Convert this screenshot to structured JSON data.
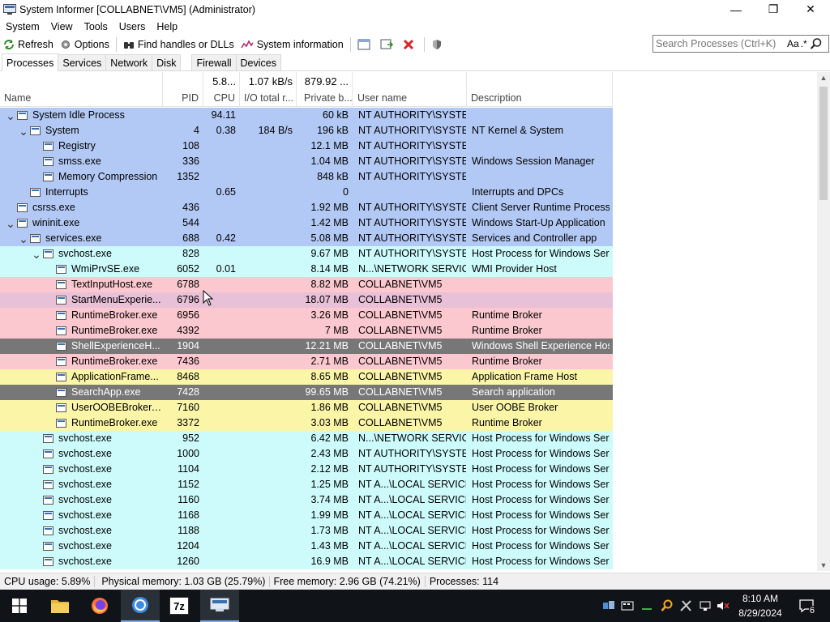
{
  "window": {
    "title": "System Informer [COLLABNET\\VM5] (Administrator)",
    "minimize": "—",
    "maximize": "❐",
    "close": "✕"
  },
  "menu": [
    "System",
    "View",
    "Tools",
    "Users",
    "Help"
  ],
  "toolbar": {
    "refresh": "Refresh",
    "options": "Options",
    "find_handles": "Find handles or DLLs",
    "system_information": "System information"
  },
  "search": {
    "placeholder": "Search Processes (Ctrl+K)",
    "case_label": "Aa",
    "regex_label": ".*"
  },
  "tabs": [
    "Processes",
    "Services",
    "Network",
    "Disk",
    "Firewall",
    "Devices"
  ],
  "columns": {
    "name": "Name",
    "pid": "PID",
    "cpu": "CPU",
    "io": "I/O total r...",
    "private": "Private b...",
    "user": "User name",
    "description": "Description"
  },
  "totals": {
    "cpu": "5.8...",
    "io": "1.07 kB/s",
    "private": "879.92 ..."
  },
  "colors": {
    "system": "#b3c9f5",
    "service": "#cdfbfb",
    "own": "#fbc8cf",
    "suspended_dark": "#777777",
    "immersive": "#fbf5a8",
    "selected_hover": "#e8c0d8"
  },
  "processes": [
    {
      "level": 0,
      "exp": "open",
      "name": "System Idle Process",
      "pid": "",
      "cpu": "94.11",
      "io": "",
      "priv": "60 kB",
      "user": "NT AUTHORITY\\SYSTEM",
      "desc": "",
      "color": "system"
    },
    {
      "level": 1,
      "exp": "open",
      "name": "System",
      "pid": "4",
      "cpu": "0.38",
      "io": "184 B/s",
      "priv": "196 kB",
      "user": "NT AUTHORITY\\SYSTEM",
      "desc": "NT Kernel & System",
      "color": "system"
    },
    {
      "level": 2,
      "exp": "",
      "name": "Registry",
      "pid": "108",
      "cpu": "",
      "io": "",
      "priv": "12.1 MB",
      "user": "NT AUTHORITY\\SYSTEM",
      "desc": "",
      "color": "system"
    },
    {
      "level": 2,
      "exp": "",
      "name": "smss.exe",
      "pid": "336",
      "cpu": "",
      "io": "",
      "priv": "1.04 MB",
      "user": "NT AUTHORITY\\SYSTEM",
      "desc": "Windows Session Manager",
      "color": "system"
    },
    {
      "level": 2,
      "exp": "",
      "name": "Memory Compression",
      "pid": "1352",
      "cpu": "",
      "io": "",
      "priv": "848 kB",
      "user": "NT AUTHORITY\\SYSTEM",
      "desc": "",
      "color": "system"
    },
    {
      "level": 1,
      "exp": "",
      "name": "Interrupts",
      "pid": "",
      "cpu": "0.65",
      "io": "",
      "priv": "0",
      "user": "",
      "desc": "Interrupts and DPCs",
      "color": "system"
    },
    {
      "level": 0,
      "exp": "",
      "name": "csrss.exe",
      "pid": "436",
      "cpu": "",
      "io": "",
      "priv": "1.92 MB",
      "user": "NT AUTHORITY\\SYSTEM",
      "desc": "Client Server Runtime Process",
      "color": "system"
    },
    {
      "level": 0,
      "exp": "open",
      "name": "wininit.exe",
      "pid": "544",
      "cpu": "",
      "io": "",
      "priv": "1.42 MB",
      "user": "NT AUTHORITY\\SYSTEM",
      "desc": "Windows Start-Up Application",
      "color": "system"
    },
    {
      "level": 1,
      "exp": "open",
      "name": "services.exe",
      "pid": "688",
      "cpu": "0.42",
      "io": "",
      "priv": "5.08 MB",
      "user": "NT AUTHORITY\\SYSTEM",
      "desc": "Services and Controller app",
      "color": "system"
    },
    {
      "level": 2,
      "exp": "open",
      "name": "svchost.exe",
      "pid": "828",
      "cpu": "",
      "io": "",
      "priv": "9.67 MB",
      "user": "NT AUTHORITY\\SYSTEM",
      "desc": "Host Process for Windows Ser...",
      "color": "service"
    },
    {
      "level": 3,
      "exp": "",
      "name": "WmiPrvSE.exe",
      "pid": "6052",
      "cpu": "0.01",
      "io": "",
      "priv": "8.14 MB",
      "user": "N...\\NETWORK SERVICE",
      "desc": "WMI Provider Host",
      "color": "service"
    },
    {
      "level": 3,
      "exp": "",
      "name": "TextInputHost.exe",
      "pid": "6788",
      "cpu": "",
      "io": "",
      "priv": "8.82 MB",
      "user": "COLLABNET\\VM5",
      "desc": "",
      "color": "own"
    },
    {
      "level": 3,
      "exp": "",
      "name": "StartMenuExperie...",
      "pid": "6796",
      "cpu": "",
      "io": "",
      "priv": "18.07 MB",
      "user": "COLLABNET\\VM5",
      "desc": "",
      "color": "selected_hover"
    },
    {
      "level": 3,
      "exp": "",
      "name": "RuntimeBroker.exe",
      "pid": "6956",
      "cpu": "",
      "io": "",
      "priv": "3.26 MB",
      "user": "COLLABNET\\VM5",
      "desc": "Runtime Broker",
      "color": "own"
    },
    {
      "level": 3,
      "exp": "",
      "name": "RuntimeBroker.exe",
      "pid": "4392",
      "cpu": "",
      "io": "",
      "priv": "7 MB",
      "user": "COLLABNET\\VM5",
      "desc": "Runtime Broker",
      "color": "own"
    },
    {
      "level": 3,
      "exp": "",
      "name": "ShellExperienceH...",
      "pid": "1904",
      "cpu": "",
      "io": "",
      "priv": "12.21 MB",
      "user": "COLLABNET\\VM5",
      "desc": "Windows Shell Experience Host",
      "color": "suspended_dark"
    },
    {
      "level": 3,
      "exp": "",
      "name": "RuntimeBroker.exe",
      "pid": "7436",
      "cpu": "",
      "io": "",
      "priv": "2.71 MB",
      "user": "COLLABNET\\VM5",
      "desc": "Runtime Broker",
      "color": "own"
    },
    {
      "level": 3,
      "exp": "",
      "name": "ApplicationFrame...",
      "pid": "8468",
      "cpu": "",
      "io": "",
      "priv": "8.65 MB",
      "user": "COLLABNET\\VM5",
      "desc": "Application Frame Host",
      "color": "immersive"
    },
    {
      "level": 3,
      "exp": "",
      "name": "SearchApp.exe",
      "pid": "7428",
      "cpu": "",
      "io": "",
      "priv": "99.65 MB",
      "user": "COLLABNET\\VM5",
      "desc": "Search application",
      "color": "suspended_dark"
    },
    {
      "level": 3,
      "exp": "",
      "name": "UserOOBEBroker....",
      "pid": "7160",
      "cpu": "",
      "io": "",
      "priv": "1.86 MB",
      "user": "COLLABNET\\VM5",
      "desc": "User OOBE Broker",
      "color": "immersive"
    },
    {
      "level": 3,
      "exp": "",
      "name": "RuntimeBroker.exe",
      "pid": "3372",
      "cpu": "",
      "io": "",
      "priv": "3.03 MB",
      "user": "COLLABNET\\VM5",
      "desc": "Runtime Broker",
      "color": "immersive"
    },
    {
      "level": 2,
      "exp": "",
      "name": "svchost.exe",
      "pid": "952",
      "cpu": "",
      "io": "",
      "priv": "6.42 MB",
      "user": "N...\\NETWORK SERVICE",
      "desc": "Host Process for Windows Ser...",
      "color": "service"
    },
    {
      "level": 2,
      "exp": "",
      "name": "svchost.exe",
      "pid": "1000",
      "cpu": "",
      "io": "",
      "priv": "2.43 MB",
      "user": "NT AUTHORITY\\SYSTEM",
      "desc": "Host Process for Windows Ser...",
      "color": "service"
    },
    {
      "level": 2,
      "exp": "",
      "name": "svchost.exe",
      "pid": "1104",
      "cpu": "",
      "io": "",
      "priv": "2.12 MB",
      "user": "NT AUTHORITY\\SYSTEM",
      "desc": "Host Process for Windows Ser...",
      "color": "service"
    },
    {
      "level": 2,
      "exp": "",
      "name": "svchost.exe",
      "pid": "1152",
      "cpu": "",
      "io": "",
      "priv": "1.25 MB",
      "user": "NT A...\\LOCAL SERVICE",
      "desc": "Host Process for Windows Ser...",
      "color": "service"
    },
    {
      "level": 2,
      "exp": "",
      "name": "svchost.exe",
      "pid": "1160",
      "cpu": "",
      "io": "",
      "priv": "3.74 MB",
      "user": "NT A...\\LOCAL SERVICE",
      "desc": "Host Process for Windows Ser...",
      "color": "service"
    },
    {
      "level": 2,
      "exp": "",
      "name": "svchost.exe",
      "pid": "1168",
      "cpu": "",
      "io": "",
      "priv": "1.99 MB",
      "user": "NT A...\\LOCAL SERVICE",
      "desc": "Host Process for Windows Ser...",
      "color": "service"
    },
    {
      "level": 2,
      "exp": "",
      "name": "svchost.exe",
      "pid": "1188",
      "cpu": "",
      "io": "",
      "priv": "1.73 MB",
      "user": "NT A...\\LOCAL SERVICE",
      "desc": "Host Process for Windows Ser...",
      "color": "service"
    },
    {
      "level": 2,
      "exp": "",
      "name": "svchost.exe",
      "pid": "1204",
      "cpu": "",
      "io": "",
      "priv": "1.43 MB",
      "user": "NT A...\\LOCAL SERVICE",
      "desc": "Host Process for Windows Ser...",
      "color": "service"
    },
    {
      "level": 2,
      "exp": "",
      "name": "svchost.exe",
      "pid": "1260",
      "cpu": "",
      "io": "",
      "priv": "16.9 MB",
      "user": "NT A...\\LOCAL SERVICE",
      "desc": "Host Process for Windows Ser...",
      "color": "service"
    }
  ],
  "status": {
    "cpu": "CPU usage: 5.89%",
    "physical": "Physical memory: 1.03 GB (25.79%)",
    "free": "Free memory: 2.96 GB (74.21%)",
    "processes": "Processes: 114"
  },
  "taskbar": {
    "time": "8:10 AM",
    "date": "8/29/2024",
    "notifications": "6",
    "apps": [
      "start-icon",
      "file-explorer-icon",
      "firefox-icon",
      "chrome-icon",
      "7zip-icon",
      "system-informer-icon"
    ],
    "sevenzip_label": "7z"
  }
}
